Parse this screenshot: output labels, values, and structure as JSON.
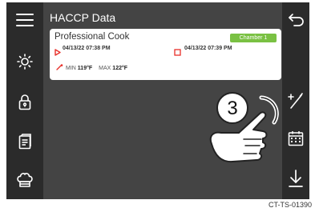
{
  "header": {
    "title": "HACCP Data"
  },
  "record": {
    "name": "Professional Cook",
    "chamber_badge": "Chamber 1",
    "start_timestamp": "04/13/22  07:38 PM",
    "end_timestamp": "04/13/22  07:39 PM",
    "min_label": "MIN",
    "min_value": "119°F",
    "max_label": "MAX",
    "max_value": "122°F"
  },
  "overlay": {
    "step_number": "3"
  },
  "footnote": "CT-TS-01390",
  "icons": {
    "left_rail": [
      "menu-icon",
      "brightness-icon",
      "lock-icon",
      "recipe-book-icon",
      "chef-hat-icon"
    ],
    "right_rail": [
      "back-arrow-icon",
      "magic-wand-icon",
      "calendar-icon",
      "download-icon"
    ]
  },
  "colors": {
    "badge": "#7ac143",
    "start_marker": "#e8302a",
    "probe": "#e8302a",
    "rails": "#2b2b2b",
    "screen": "#444444"
  }
}
